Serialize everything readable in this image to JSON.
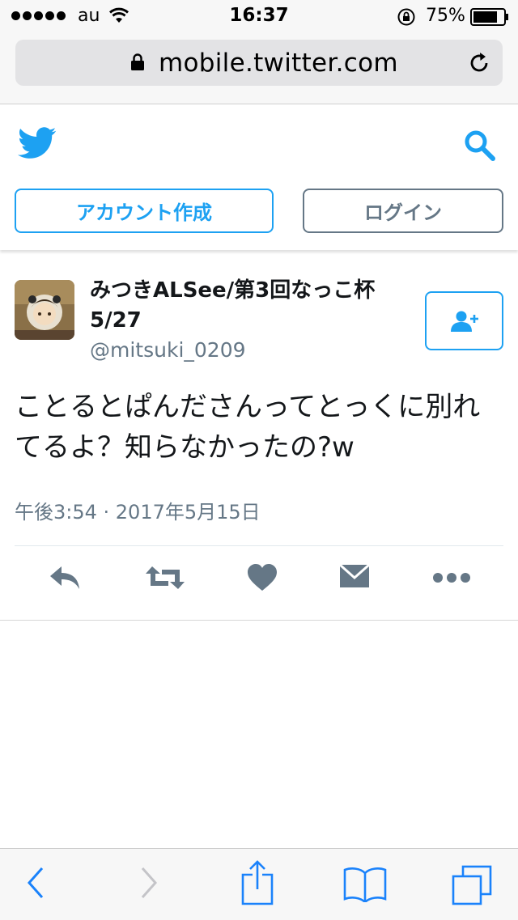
{
  "status_bar": {
    "carrier": "au",
    "time": "16:37",
    "battery_percent": "75%",
    "signal_dots": 5
  },
  "browser": {
    "url": "mobile.twitter.com"
  },
  "header": {
    "signup_label": "アカウント作成",
    "login_label": "ログイン",
    "brand_color": "#1da1f2",
    "icons": [
      "twitter-bird-icon",
      "search-icon"
    ]
  },
  "tweet": {
    "author_name": "みつきALSee/第3回なっこ杯 5/27",
    "author_handle": "@mitsuki_0209",
    "text": "ことるとぱんださんってとっくに別れてるよ？知らなかったの?w",
    "timestamp": "午後3:54 · 2017年5月15日",
    "actions": [
      "reply-icon",
      "retweet-icon",
      "like-icon",
      "message-icon",
      "more-icon"
    ]
  },
  "toolbar": {
    "icons": [
      "back-icon",
      "forward-icon",
      "share-icon",
      "bookmarks-icon",
      "tabs-icon"
    ]
  }
}
